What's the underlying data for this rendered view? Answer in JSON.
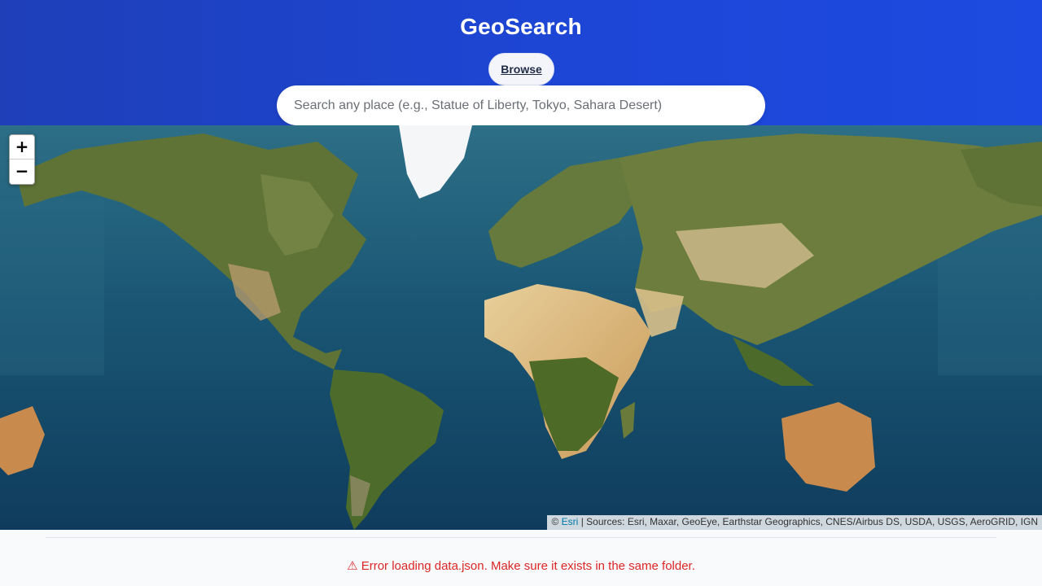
{
  "header": {
    "title": "GeoSearch",
    "browse_label": "Browse",
    "search_placeholder": "Search any place (e.g., Statue of Liberty, Tokyo, Sahara Desert)",
    "search_value": ""
  },
  "map": {
    "zoom_in_label": "+",
    "zoom_out_label": "−",
    "attribution_prefix": "©",
    "attribution_link": "Esri",
    "attribution_sources": "| Sources: Esri, Maxar, GeoEye, Earthstar Geographics, CNES/Airbus DS, USDA, USGS, AeroGRID, IGN",
    "layer": "satellite imagery"
  },
  "status": {
    "error_text": "⚠ Error loading data.json. Make sure it exists in the same folder."
  },
  "colors": {
    "header_bg": "#1d46d6",
    "ocean": "#174d6b",
    "error": "#dc2626",
    "link": "#0078a8"
  }
}
